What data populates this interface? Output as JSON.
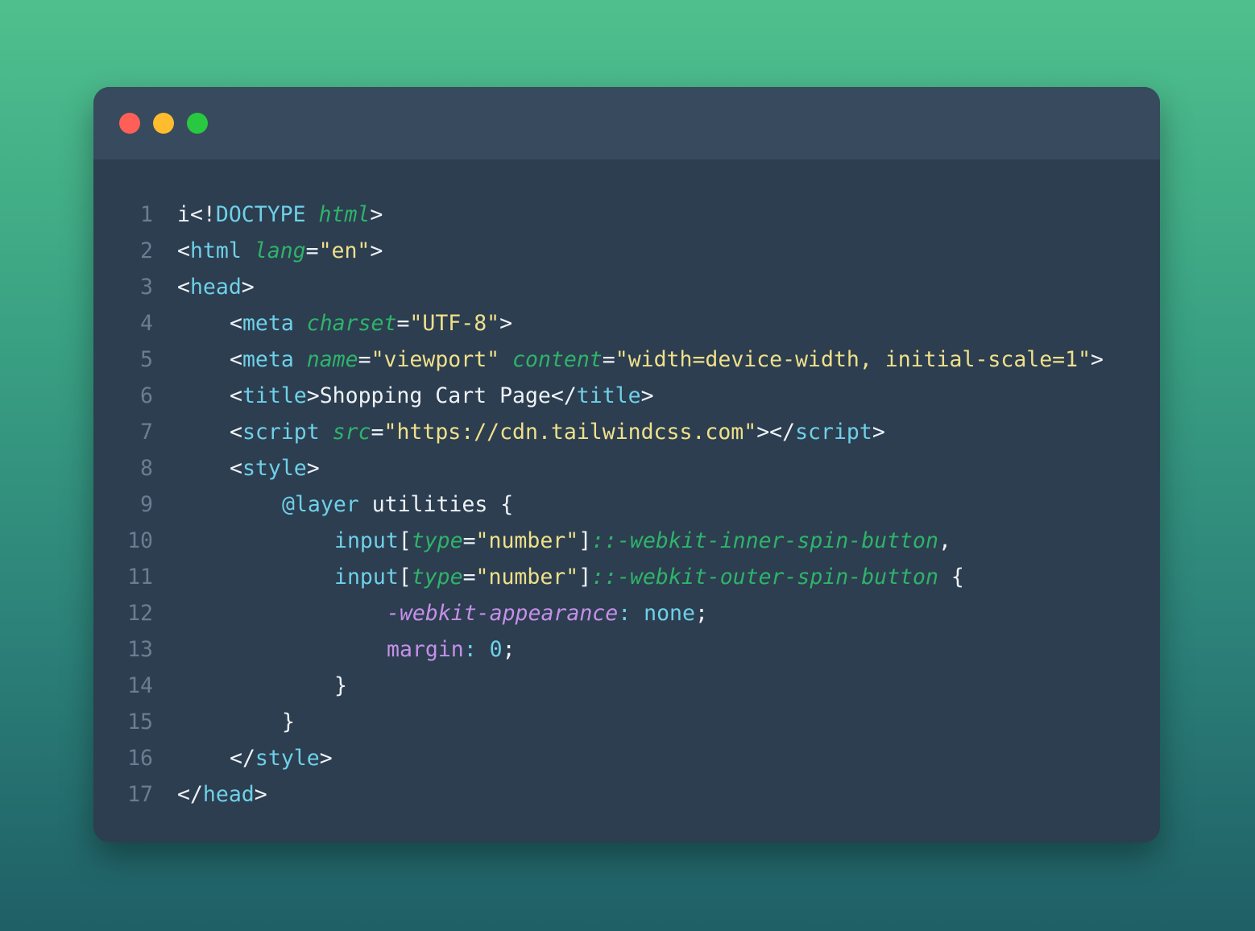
{
  "window": {
    "controls": {
      "close_color": "#ff5f57",
      "minimize_color": "#febc2e",
      "zoom_color": "#28c840"
    }
  },
  "code": {
    "lines": [
      {
        "n": "1",
        "indent": 0,
        "tokens": [
          {
            "t": "i<!",
            "k": "text"
          },
          {
            "t": "DOCTYPE",
            "k": "tag"
          },
          {
            "t": " ",
            "k": "text"
          },
          {
            "t": "html",
            "k": "attr"
          },
          {
            "t": ">",
            "k": "text"
          }
        ]
      },
      {
        "n": "2",
        "indent": 0,
        "tokens": [
          {
            "t": "<",
            "k": "text"
          },
          {
            "t": "html",
            "k": "tag"
          },
          {
            "t": " ",
            "k": "text"
          },
          {
            "t": "lang",
            "k": "attr"
          },
          {
            "t": "=",
            "k": "text"
          },
          {
            "t": "\"en\"",
            "k": "str"
          },
          {
            "t": ">",
            "k": "text"
          }
        ]
      },
      {
        "n": "3",
        "indent": 0,
        "tokens": [
          {
            "t": "<",
            "k": "text"
          },
          {
            "t": "head",
            "k": "tag"
          },
          {
            "t": ">",
            "k": "text"
          }
        ]
      },
      {
        "n": "4",
        "indent": 1,
        "tokens": [
          {
            "t": "<",
            "k": "text"
          },
          {
            "t": "meta",
            "k": "tag"
          },
          {
            "t": " ",
            "k": "text"
          },
          {
            "t": "charset",
            "k": "attr"
          },
          {
            "t": "=",
            "k": "text"
          },
          {
            "t": "\"UTF-8\"",
            "k": "str"
          },
          {
            "t": ">",
            "k": "text"
          }
        ]
      },
      {
        "n": "5",
        "indent": 1,
        "tokens": [
          {
            "t": "<",
            "k": "text"
          },
          {
            "t": "meta",
            "k": "tag"
          },
          {
            "t": " ",
            "k": "text"
          },
          {
            "t": "name",
            "k": "attr"
          },
          {
            "t": "=",
            "k": "text"
          },
          {
            "t": "\"viewport\"",
            "k": "str"
          },
          {
            "t": " ",
            "k": "text"
          },
          {
            "t": "content",
            "k": "attr"
          },
          {
            "t": "=",
            "k": "text"
          },
          {
            "t": "\"width=device-width, initial-scale=1\"",
            "k": "str"
          },
          {
            "t": ">",
            "k": "text"
          }
        ]
      },
      {
        "n": "6",
        "indent": 1,
        "tokens": [
          {
            "t": "<",
            "k": "text"
          },
          {
            "t": "title",
            "k": "tag"
          },
          {
            "t": ">Shopping Cart Page</",
            "k": "text"
          },
          {
            "t": "title",
            "k": "tag"
          },
          {
            "t": ">",
            "k": "text"
          }
        ]
      },
      {
        "n": "7",
        "indent": 1,
        "tokens": [
          {
            "t": "<",
            "k": "text"
          },
          {
            "t": "script",
            "k": "tag"
          },
          {
            "t": " ",
            "k": "text"
          },
          {
            "t": "src",
            "k": "attr"
          },
          {
            "t": "=",
            "k": "text"
          },
          {
            "t": "\"https://cdn.tailwindcss.com\"",
            "k": "str"
          },
          {
            "t": "></",
            "k": "text"
          },
          {
            "t": "script",
            "k": "tag"
          },
          {
            "t": ">",
            "k": "text"
          }
        ]
      },
      {
        "n": "8",
        "indent": 1,
        "tokens": [
          {
            "t": "<",
            "k": "text"
          },
          {
            "t": "style",
            "k": "tag"
          },
          {
            "t": ">",
            "k": "text"
          }
        ]
      },
      {
        "n": "9",
        "indent": 2,
        "tokens": [
          {
            "t": "@layer",
            "k": "tag"
          },
          {
            "t": " utilities {",
            "k": "text"
          }
        ]
      },
      {
        "n": "10",
        "indent": 3,
        "tokens": [
          {
            "t": "input",
            "k": "tag"
          },
          {
            "t": "[",
            "k": "text"
          },
          {
            "t": "type",
            "k": "attr"
          },
          {
            "t": "=",
            "k": "text"
          },
          {
            "t": "\"number\"",
            "k": "str"
          },
          {
            "t": "]",
            "k": "text"
          },
          {
            "t": "::-webkit-inner-spin-button",
            "k": "pseudo"
          },
          {
            "t": ",",
            "k": "text"
          }
        ]
      },
      {
        "n": "11",
        "indent": 3,
        "tokens": [
          {
            "t": "input",
            "k": "tag"
          },
          {
            "t": "[",
            "k": "text"
          },
          {
            "t": "type",
            "k": "attr"
          },
          {
            "t": "=",
            "k": "text"
          },
          {
            "t": "\"number\"",
            "k": "str"
          },
          {
            "t": "]",
            "k": "text"
          },
          {
            "t": "::-webkit-outer-spin-button",
            "k": "pseudo"
          },
          {
            "t": " {",
            "k": "text"
          }
        ]
      },
      {
        "n": "12",
        "indent": 4,
        "tokens": [
          {
            "t": "-webkit-appearance",
            "k": "prop-i"
          },
          {
            "t": ": ",
            "k": "val"
          },
          {
            "t": "none",
            "k": "val"
          },
          {
            "t": ";",
            "k": "text"
          }
        ]
      },
      {
        "n": "13",
        "indent": 4,
        "tokens": [
          {
            "t": "margin",
            "k": "prop"
          },
          {
            "t": ": ",
            "k": "val"
          },
          {
            "t": "0",
            "k": "val"
          },
          {
            "t": ";",
            "k": "text"
          }
        ]
      },
      {
        "n": "14",
        "indent": 3,
        "tokens": [
          {
            "t": "}",
            "k": "text"
          }
        ]
      },
      {
        "n": "15",
        "indent": 2,
        "tokens": [
          {
            "t": "}",
            "k": "text"
          }
        ]
      },
      {
        "n": "16",
        "indent": 1,
        "tokens": [
          {
            "t": "</",
            "k": "text"
          },
          {
            "t": "style",
            "k": "tag"
          },
          {
            "t": ">",
            "k": "text"
          }
        ]
      },
      {
        "n": "17",
        "indent": 0,
        "tokens": [
          {
            "t": "</",
            "k": "text"
          },
          {
            "t": "head",
            "k": "tag"
          },
          {
            "t": ">",
            "k": "text"
          }
        ]
      }
    ]
  }
}
